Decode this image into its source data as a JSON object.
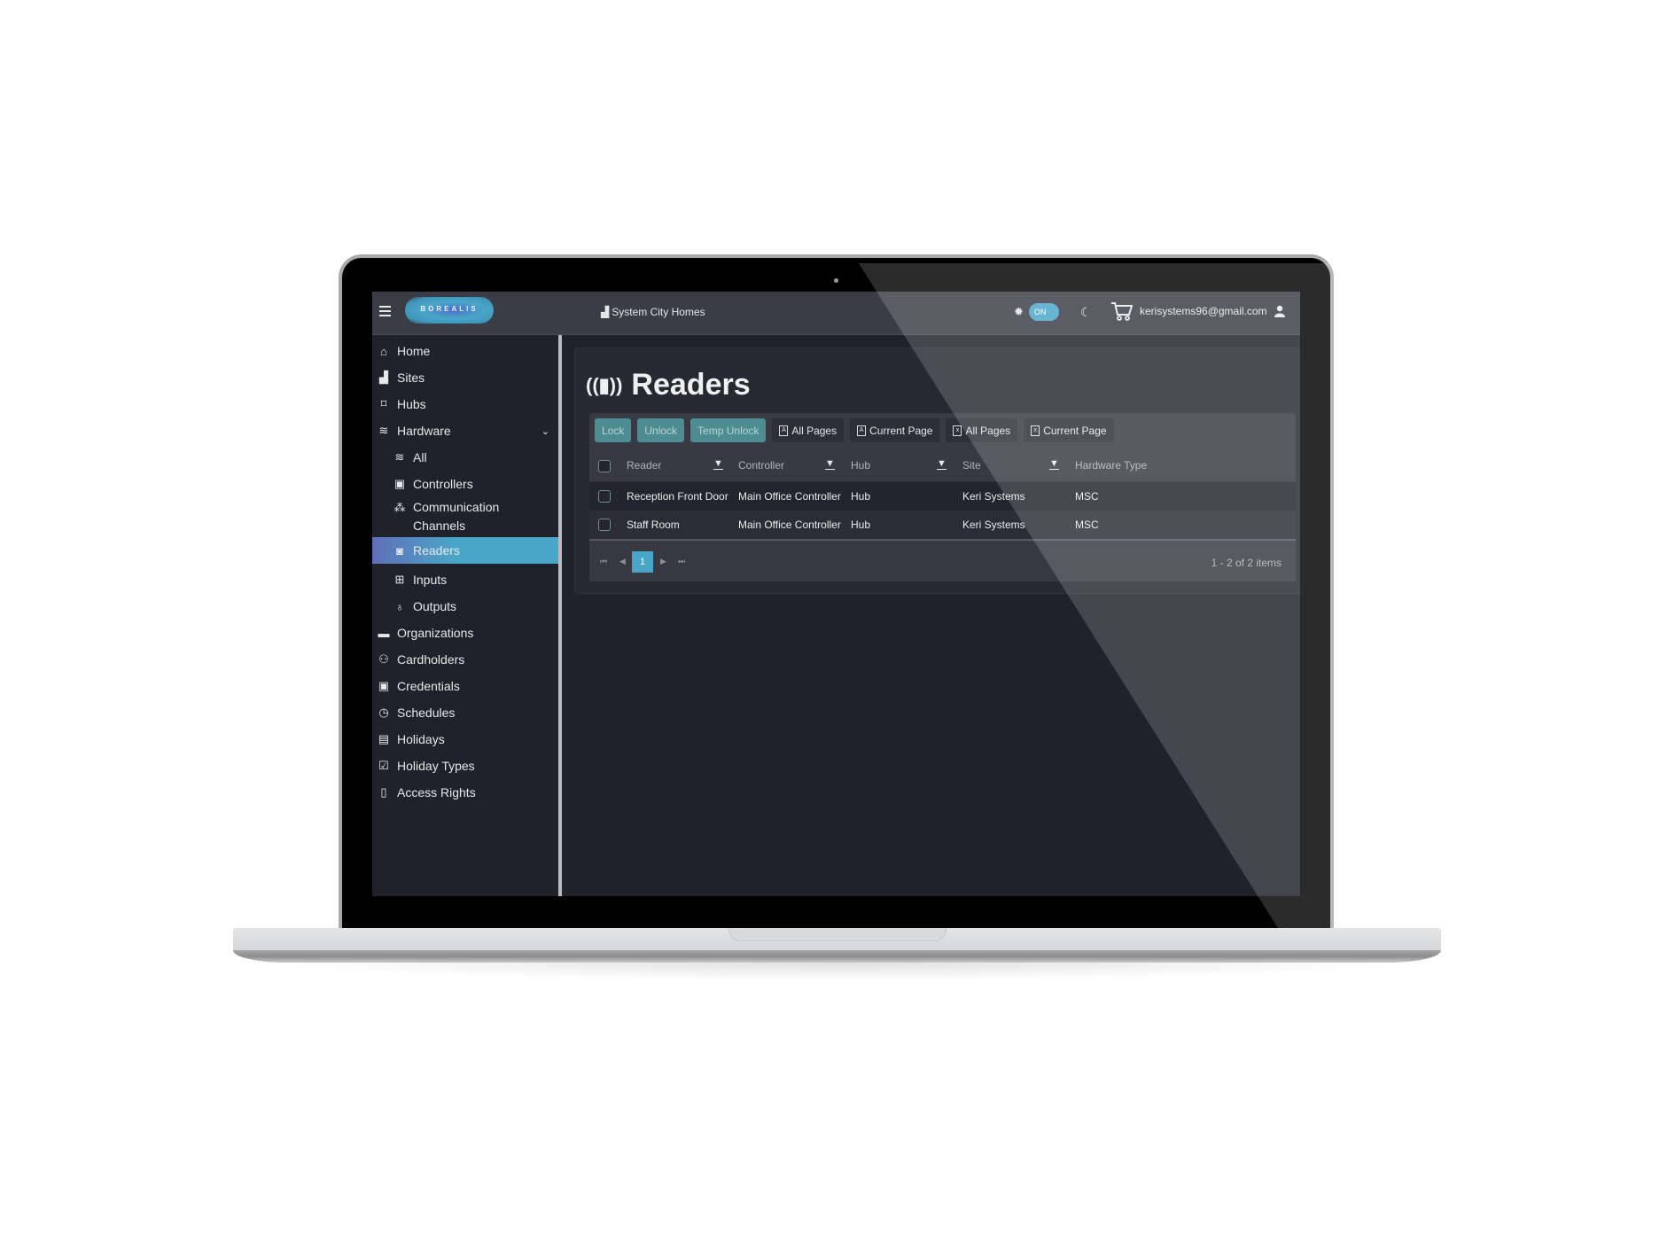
{
  "header": {
    "logo_text": "BOREALIS",
    "site_name": "System City Homes",
    "theme_toggle_label": "ON",
    "user_email": "kerisystems96@gmail.com"
  },
  "sidebar": {
    "items": [
      {
        "label": "Home",
        "icon": "home-icon"
      },
      {
        "label": "Sites",
        "icon": "building-icon"
      },
      {
        "label": "Hubs",
        "icon": "hub-icon"
      },
      {
        "label": "Hardware",
        "icon": "layers-icon",
        "expanded": true
      },
      {
        "label": "All",
        "icon": "layers-icon",
        "sub": true
      },
      {
        "label": "Controllers",
        "icon": "controller-icon",
        "sub": true
      },
      {
        "label": "Communication Channels",
        "icon": "network-icon",
        "sub": true
      },
      {
        "label": "Readers",
        "icon": "reader-icon",
        "sub": true,
        "active": true
      },
      {
        "label": "Inputs",
        "icon": "plus-square-icon",
        "sub": true
      },
      {
        "label": "Outputs",
        "icon": "lightbulb-icon",
        "sub": true
      },
      {
        "label": "Organizations",
        "icon": "briefcase-icon"
      },
      {
        "label": "Cardholders",
        "icon": "user-plus-icon"
      },
      {
        "label": "Credentials",
        "icon": "id-card-icon"
      },
      {
        "label": "Schedules",
        "icon": "clock-icon"
      },
      {
        "label": "Holidays",
        "icon": "calendar-icon"
      },
      {
        "label": "Holiday Types",
        "icon": "calendar-check-icon"
      },
      {
        "label": "Access Rights",
        "icon": "door-icon"
      }
    ]
  },
  "main": {
    "title": "Readers",
    "toolbar": {
      "lock": "Lock",
      "unlock": "Unlock",
      "temp_unlock": "Temp Unlock",
      "pdf_all": "All Pages",
      "pdf_current": "Current Page",
      "excel_all": "All Pages",
      "excel_current": "Current Page"
    },
    "table": {
      "columns": [
        "Reader",
        "Controller",
        "Hub",
        "Site",
        "Hardware Type"
      ],
      "rows": [
        [
          "Reception Front Door",
          "Main Office Controller",
          "Hub",
          "Keri Systems",
          "MSC"
        ],
        [
          "Staff Room",
          "Main Office Controller",
          "Hub",
          "Keri Systems",
          "MSC"
        ]
      ]
    },
    "pager": {
      "current_page": "1",
      "info": "1 - 2 of 2 items"
    }
  },
  "colors": {
    "accent": "#4aa6c8",
    "action_button": "#4d8c91",
    "background": "#1f222a",
    "header": "#3a3d46"
  }
}
